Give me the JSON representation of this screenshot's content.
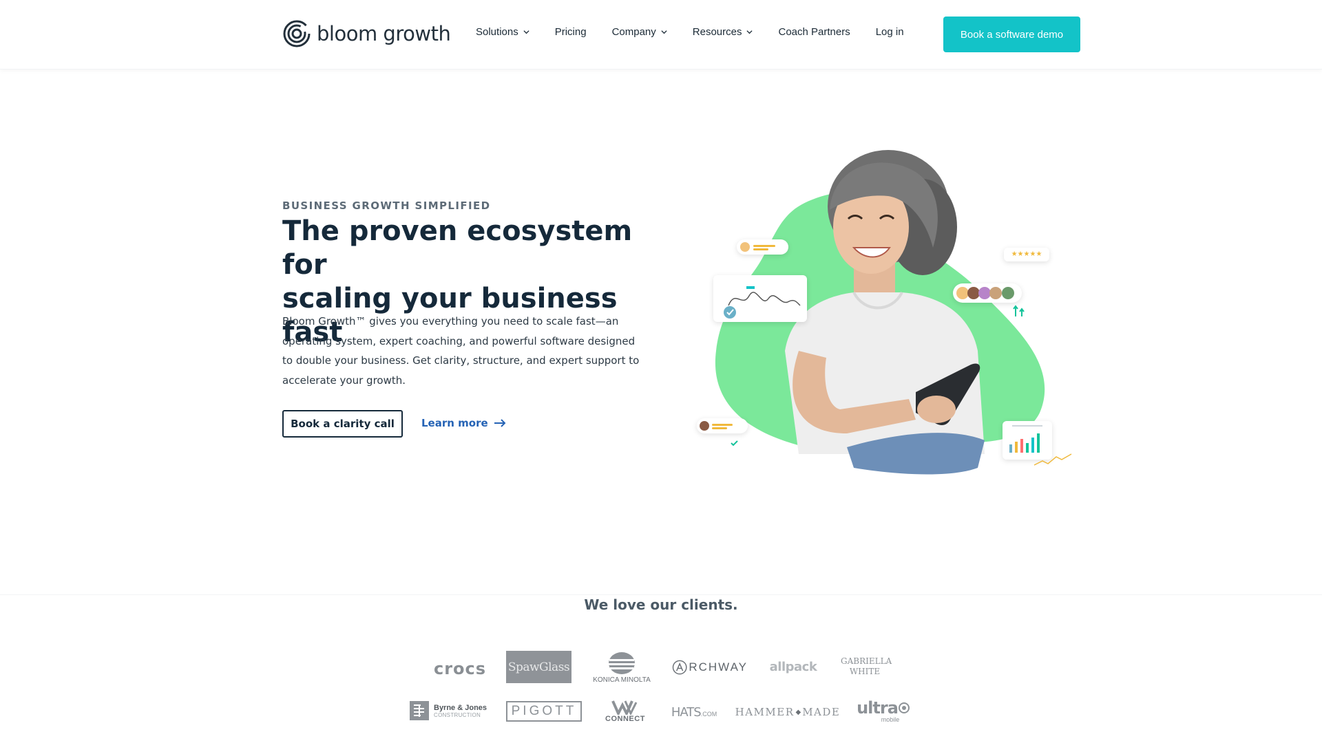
{
  "header": {
    "logo_text": "bloom growth",
    "nav": [
      {
        "label": "Solutions",
        "dropdown": true
      },
      {
        "label": "Pricing",
        "dropdown": false
      },
      {
        "label": "Company",
        "dropdown": true
      },
      {
        "label": "Resources",
        "dropdown": true
      },
      {
        "label": "Coach Partners",
        "dropdown": false
      },
      {
        "label": "Log in",
        "dropdown": false
      }
    ],
    "cta_label": "Book a software demo"
  },
  "hero": {
    "eyebrow": "BUSINESS GROWTH SIMPLIFIED",
    "headline_line1": "The proven ecosystem for",
    "headline_line2": "scaling your business fast",
    "description": "Bloom Growth™ gives you everything you need to scale fast—an operating system, expert coaching, and powerful software designed to double your business. Get clarity, structure, and expert support to accelerate your growth.",
    "primary_button": "Book a clarity call",
    "secondary_link": "Learn more",
    "rating_stars": "★★★★★"
  },
  "clients": {
    "title": "We love our clients.",
    "row1": [
      "crocs",
      "SpawGlass",
      "KONICA MINOLTA",
      "RCHWAY",
      "allpack",
      "GABRIELLA WHITE"
    ],
    "row2": [
      "Byrne & Jones",
      "CONSTRUCTION",
      "PIGOTT",
      "CONNECT",
      "HATS",
      ".COM",
      "HAMMER",
      "MADE",
      "ultra",
      "mobile"
    ]
  },
  "colors": {
    "accent": "#13c3c8",
    "heading": "#15293a",
    "link": "#2563b5",
    "blob": "#7be89a"
  }
}
